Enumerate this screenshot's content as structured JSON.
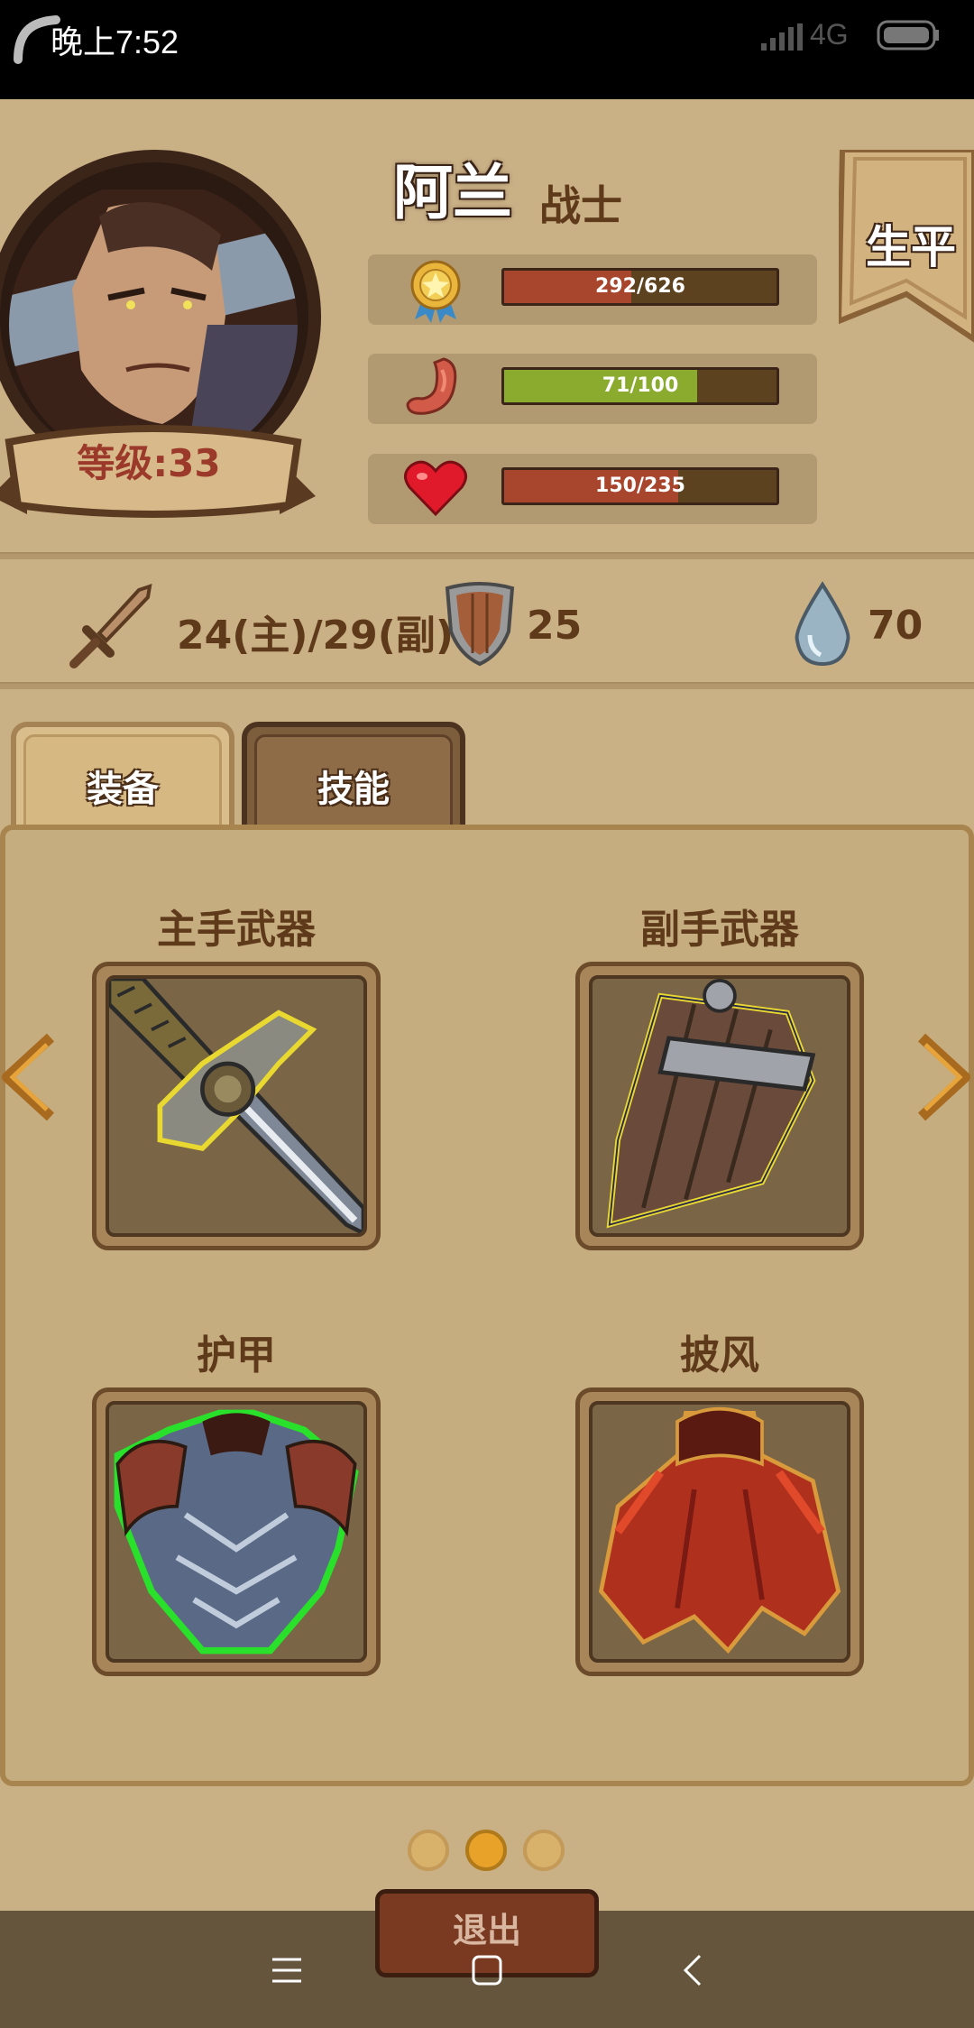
{
  "status_bar": {
    "time": "晚上7:52",
    "network": "4G"
  },
  "hero": {
    "name": "阿兰",
    "class": "战士",
    "level_label": "等级:33"
  },
  "biography_button": "生平",
  "stats": {
    "experience": {
      "text": "292/626",
      "value": 292,
      "max": 626,
      "icon": "medal-icon",
      "color": "#a8452d"
    },
    "hunger": {
      "text": "71/100",
      "value": 71,
      "max": 100,
      "icon": "stomach-icon",
      "color": "#8aab2e"
    },
    "health": {
      "text": "150/235",
      "value": 150,
      "max": 235,
      "icon": "heart-icon",
      "color": "#a8452d"
    }
  },
  "combat": {
    "attack": "24(主)/29(副)",
    "defense": "25",
    "mana": "70"
  },
  "tabs": {
    "equipment": "装备",
    "skills": "技能"
  },
  "slots": {
    "main_weapon": {
      "title": "主手武器",
      "icon": "sword-icon"
    },
    "off_weapon": {
      "title": "副手武器",
      "icon": "wooden-shield-icon"
    },
    "armor": {
      "title": "护甲",
      "icon": "chest-armor-icon"
    },
    "cloak": {
      "title": "披风",
      "icon": "red-cloak-icon"
    }
  },
  "pagination": {
    "count": 3,
    "active_index": 1
  },
  "exit_button": "退出",
  "colors": {
    "background": "#c9b085",
    "accent_brown": "#5e3a1a",
    "active_dot": "#e8a22a"
  }
}
